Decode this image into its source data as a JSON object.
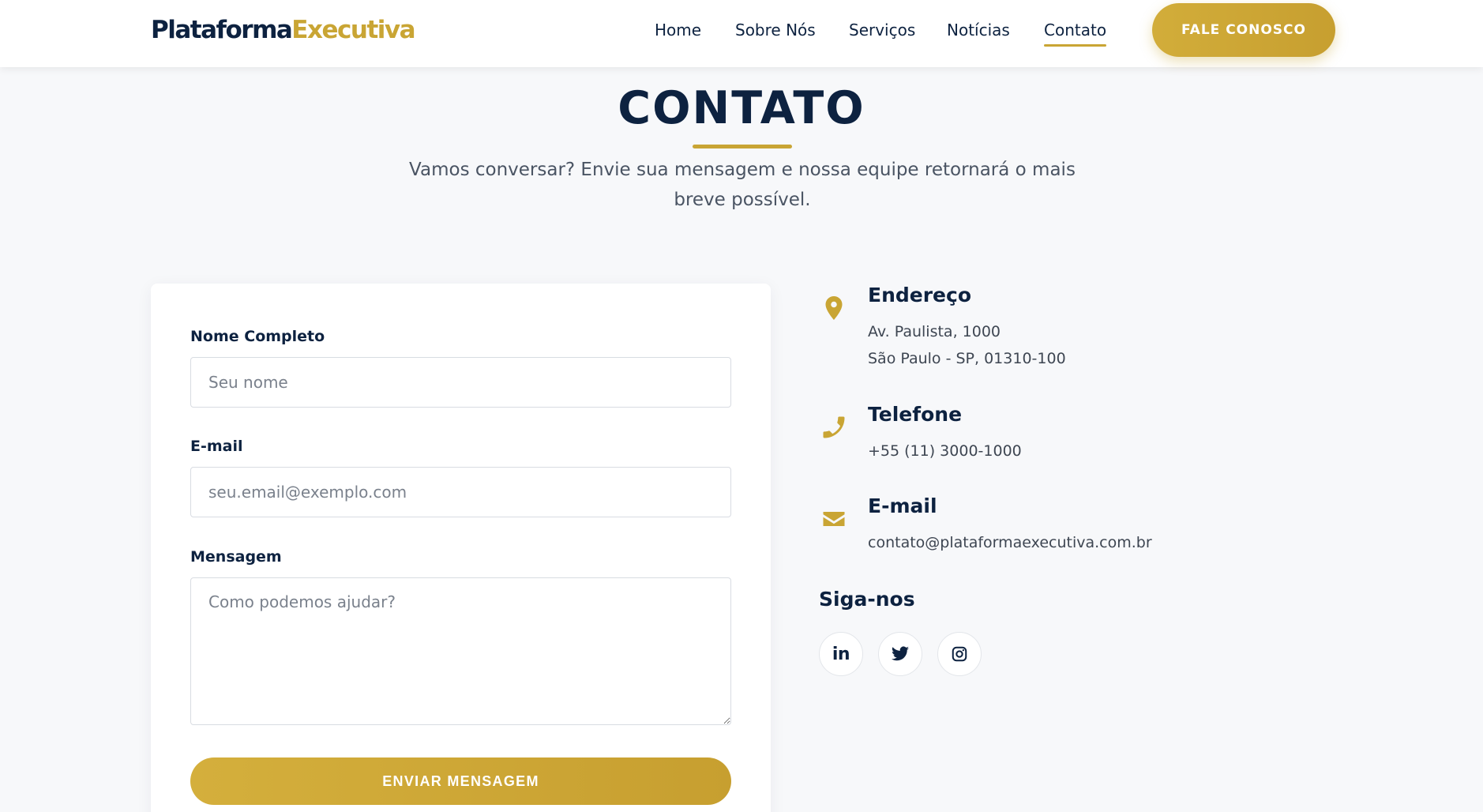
{
  "header": {
    "logo_part1": "Plataforma",
    "logo_part2": "Executiva",
    "nav": [
      {
        "label": "Home"
      },
      {
        "label": "Sobre Nós"
      },
      {
        "label": "Serviços"
      },
      {
        "label": "Notícias"
      },
      {
        "label": "Contato",
        "active": true
      }
    ],
    "cta_label": "FALE CONOSCO"
  },
  "hero": {
    "title": "CONTATO",
    "subtitle": "Vamos conversar? Envie sua mensagem e nossa equipe retornará o mais breve possível."
  },
  "form": {
    "name_label": "Nome Completo",
    "name_placeholder": "Seu nome",
    "email_label": "E-mail",
    "email_placeholder": "seu.email@exemplo.com",
    "message_label": "Mensagem",
    "message_placeholder": "Como podemos ajudar?",
    "submit_label": "ENVIAR MENSAGEM"
  },
  "contact_info": {
    "address": {
      "title": "Endereço",
      "line1": "Av. Paulista, 1000",
      "line2": "São Paulo - SP, 01310-100",
      "icon": "map-pin-icon"
    },
    "phone": {
      "title": "Telefone",
      "line1": "+55 (11) 3000-1000",
      "icon": "phone-icon"
    },
    "email": {
      "title": "E-mail",
      "line1": "contato@plataformaexecutiva.com.br",
      "icon": "envelope-icon"
    }
  },
  "social": {
    "title": "Siga-nos",
    "linkedin_label": "in",
    "items": [
      "linkedin-icon",
      "twitter-icon",
      "instagram-icon"
    ]
  },
  "colors": {
    "navy": "#0d2240",
    "gold": "#c9a534",
    "background": "#f7f8fa"
  }
}
